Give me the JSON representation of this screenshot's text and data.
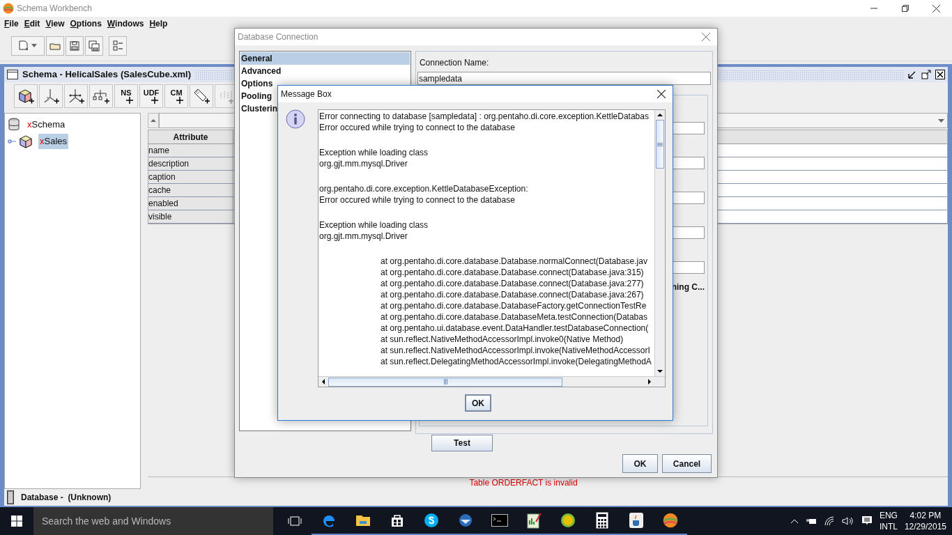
{
  "window": {
    "title": "Schema Workbench"
  },
  "menu": [
    "File",
    "Edit",
    "View",
    "Options",
    "Windows",
    "Help"
  ],
  "schema_frame": {
    "title": "Schema - HelicalSales (SalesCube.xml)",
    "toolbar": [
      {
        "kind": "cube"
      },
      {
        "kind": "dimension"
      },
      {
        "kind": "hierarchy"
      },
      {
        "kind": "tree"
      },
      {
        "kind": "text",
        "label": "NS"
      },
      {
        "kind": "text",
        "label": "UDF"
      },
      {
        "kind": "text",
        "label": "CM"
      },
      {
        "kind": "tag"
      },
      {
        "kind": "faded"
      }
    ],
    "tree": [
      {
        "mark": "x",
        "label": "Schema",
        "kind": "database",
        "selected": false,
        "children": [
          {
            "mark": "x",
            "label": "Sales",
            "kind": "cube",
            "selected": true
          }
        ]
      }
    ],
    "table": {
      "columns": [
        "Attribute"
      ],
      "rows": [
        "name",
        "description",
        "caption",
        "cache",
        "enabled",
        "visible"
      ]
    },
    "message": "Table ORDERFACT is invalid"
  },
  "status_bar": {
    "label": "Database -",
    "value": "(Unknown)"
  },
  "database_dialog": {
    "title": "Database Connection",
    "sections": [
      {
        "label": "General",
        "selected": true
      },
      {
        "label": "Advanced",
        "selected": false
      },
      {
        "label": "Options",
        "selected": false
      },
      {
        "label": "Pooling",
        "selected": false
      },
      {
        "label": "Clusterin",
        "selected": false
      }
    ],
    "connection_name_label": "Connection Name:",
    "connection_name": "sampledata",
    "partial_label": "ning C...",
    "buttons": {
      "test": "Test",
      "ok": "OK",
      "cancel": "Cancel"
    }
  },
  "message_box": {
    "title": "Message Box",
    "ok": "OK",
    "blocks": [
      {
        "kind": "message",
        "lines": [
          "Error connecting to database [sampledata] : org.pentaho.di.core.exception.KettleDatabas",
          "Error occured while trying to connect to the database"
        ]
      },
      {
        "kind": "message",
        "lines": [
          "Exception while loading class",
          "org.gjt.mm.mysql.Driver"
        ]
      },
      {
        "kind": "message",
        "lines": [
          "org.pentaho.di.core.exception.KettleDatabaseException:",
          "Error occured while trying to connect to the database"
        ]
      },
      {
        "kind": "message",
        "lines": [
          "Exception while loading class",
          "org.gjt.mm.mysql.Driver"
        ]
      },
      {
        "kind": "trace",
        "lines": [
          "at org.pentaho.di.core.database.Database.normalConnect(Database.jav",
          "at org.pentaho.di.core.database.Database.connect(Database.java:315)",
          "at org.pentaho.di.core.database.Database.connect(Database.java:277)",
          "at org.pentaho.di.core.database.Database.connect(Database.java:267)",
          "at org.pentaho.di.core.database.DatabaseFactory.getConnectionTestRe",
          "at org.pentaho.di.core.database.DatabaseMeta.testConnection(Databas",
          "at org.pentaho.ui.database.event.DataHandler.testDatabaseConnection(",
          "at sun.reflect.NativeMethodAccessorImpl.invoke0(Native Method)",
          "at sun.reflect.NativeMethodAccessorImpl.invoke(NativeMethodAccessorI",
          "at sun.reflect.DelegatingMethodAccessorImpl.invoke(DelegatingMethodA"
        ]
      }
    ]
  },
  "taskbar": {
    "search_placeholder": "Search the web and Windows",
    "language": "ENG",
    "layout": "INTL",
    "time": "4:02 PM",
    "date": "12/29/2015"
  }
}
